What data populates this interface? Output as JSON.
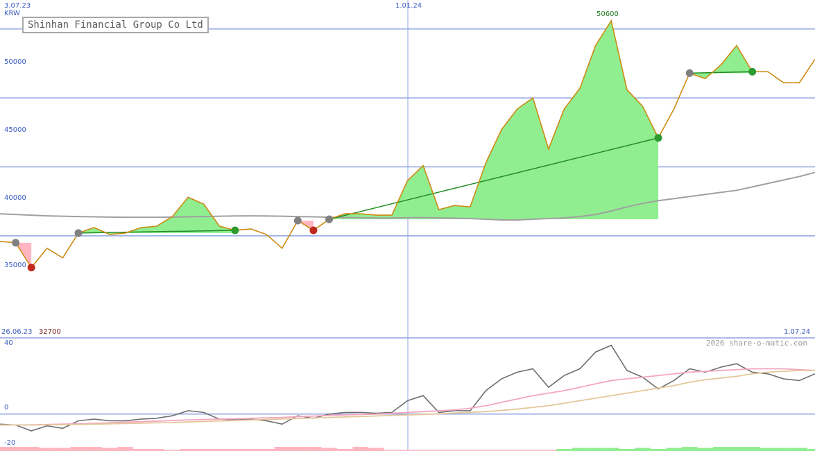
{
  "title": "Shinhan Financial Group Co Ltd",
  "currency": "KRW",
  "date_labels": {
    "top_left": "3.07.23",
    "top_mid": "1.01.24",
    "bottom_left": "26.06.23",
    "bottom_right": "1.07.24"
  },
  "max_label": "50600",
  "min_label": "32700",
  "watermark": "2026 share-o-matic.com",
  "colors": {
    "price_line": "#cc8a12",
    "green_fill": "#90ee90",
    "red_fill": "#ffb6c1",
    "trend_line": "#228b22",
    "ma_line": "#a0a0a0",
    "grid": "#8fa4e0",
    "axis_text": "#3a5bbf",
    "osc_main": "#6e6e6e",
    "osc_pink": "#f4a6c0",
    "osc_tan": "#e3c79a"
  },
  "chart_data": [
    {
      "type": "line",
      "title": "Shinhan Financial Group Co Ltd",
      "ylabel": "KRW",
      "x_start": "26.06.23",
      "x_end": "1.07.24",
      "ylim": [
        27600,
        52100
      ],
      "yticks": [
        "35000",
        "40000",
        "45000",
        "50000"
      ],
      "xticks": [
        "1.01.24"
      ],
      "grid": true,
      "series": [
        {
          "key": "price",
          "values": [
            34600,
            34500,
            32700,
            34100,
            33400,
            35200,
            35600,
            35100,
            35200,
            35600,
            35700,
            36400,
            37800,
            37300,
            35700,
            35400,
            35500,
            35100,
            34100,
            36100,
            35400,
            36200,
            36600,
            36600,
            36500,
            36500,
            39000,
            40100,
            36900,
            37200,
            37100,
            40300,
            42700,
            44200,
            45000,
            41300,
            44200,
            45700,
            48800,
            50600,
            45600,
            44400,
            42100,
            44200,
            46800,
            46400,
            47400,
            48800,
            46900,
            46900,
            46100,
            46100,
            47800
          ]
        },
        {
          "key": "moving_average",
          "values": [
            36600,
            36550,
            36500,
            36450,
            36420,
            36400,
            36380,
            36360,
            36350,
            36350,
            36350,
            36360,
            36380,
            36400,
            36420,
            36440,
            36450,
            36440,
            36420,
            36400,
            36380,
            36350,
            36330,
            36310,
            36300,
            36300,
            36310,
            36320,
            36300,
            36280,
            36250,
            36200,
            36150,
            36150,
            36200,
            36250,
            36300,
            36400,
            36550,
            36800,
            37100,
            37350,
            37550,
            37700,
            37850,
            38000,
            38150,
            38300,
            38550,
            38800,
            39050,
            39300,
            39600
          ]
        }
      ],
      "signals": [
        {
          "kind": "sell",
          "from": 1,
          "to": 2
        },
        {
          "kind": "buy",
          "from": 5,
          "to": 15
        },
        {
          "kind": "sell",
          "from": 19,
          "to": 20
        },
        {
          "kind": "buy",
          "from": 21,
          "to": 42
        },
        {
          "kind": "buy",
          "from": 44,
          "to": 48
        }
      ]
    },
    {
      "type": "line",
      "title": "",
      "ylim": [
        -22,
        45
      ],
      "yticks": [
        "40",
        "0",
        "-20"
      ],
      "series": [
        {
          "key": "oscillator",
          "values": [
            -6,
            -6.5,
            -10,
            -7,
            -8.5,
            -4,
            -3,
            -4,
            -4,
            -3,
            -2.5,
            -1,
            2,
            1,
            -3,
            -3.5,
            -3,
            -4,
            -6,
            -1,
            -2.5,
            0,
            1,
            1,
            0.5,
            1,
            8,
            11,
            1,
            2,
            2,
            14,
            21,
            25,
            27,
            16,
            23,
            27,
            37,
            41,
            26,
            22,
            15,
            20,
            27,
            25,
            28,
            30,
            25,
            24,
            21,
            20,
            24
          ]
        },
        {
          "key": "signal_pink",
          "values": [
            -6.5,
            -6.5,
            -6.4,
            -6.2,
            -6,
            -5.8,
            -5.5,
            -5.2,
            -4.8,
            -4.5,
            -4.2,
            -3.8,
            -3.5,
            -3.2,
            -3,
            -2.8,
            -2.5,
            -2.2,
            -2,
            -1.5,
            -1.2,
            -0.8,
            -0.5,
            -0.2,
            0,
            0.5,
            1,
            1.5,
            2,
            2.5,
            3.5,
            5,
            7,
            9,
            11,
            12.5,
            14,
            16,
            18,
            20,
            21,
            22,
            23,
            24,
            25,
            25.5,
            26,
            26.5,
            27,
            27,
            27,
            26.5,
            26
          ]
        },
        {
          "key": "signal_tan",
          "values": [
            -6.5,
            -6.5,
            -6.5,
            -6.4,
            -6.3,
            -6.2,
            -6,
            -5.8,
            -5.6,
            -5.4,
            -5.2,
            -5,
            -4.7,
            -4.4,
            -4.1,
            -3.8,
            -3.5,
            -3.2,
            -2.9,
            -2.6,
            -2.3,
            -2,
            -1.7,
            -1.4,
            -1.1,
            -0.8,
            -0.5,
            -0.2,
            0.2,
            0.6,
            1,
            1.5,
            2.2,
            3,
            4,
            5,
            6.5,
            8,
            9.5,
            11,
            12.5,
            14,
            15.5,
            17,
            19,
            20.5,
            21.5,
            22.5,
            24,
            25,
            25.5,
            26,
            26
          ]
        }
      ],
      "histogram": [
        -2,
        -2,
        -2,
        -1.5,
        -1.5,
        -2,
        -2,
        -1.5,
        -2,
        -1,
        -1,
        -0.5,
        -1,
        -1,
        -1,
        -1,
        -1,
        -1,
        -2,
        -2,
        -2,
        -1.5,
        -1,
        -2,
        -1.5,
        -0.5,
        -0.5,
        -0.5,
        -0.5,
        -0.5,
        -0.5,
        -0.5,
        -0.5,
        -0.5,
        -0.5,
        -0.5,
        1,
        1.5,
        1.5,
        1.5,
        1,
        1.5,
        1,
        1.5,
        2,
        1.5,
        2,
        2,
        2,
        1.5,
        1.5,
        1.5,
        1
      ]
    }
  ]
}
